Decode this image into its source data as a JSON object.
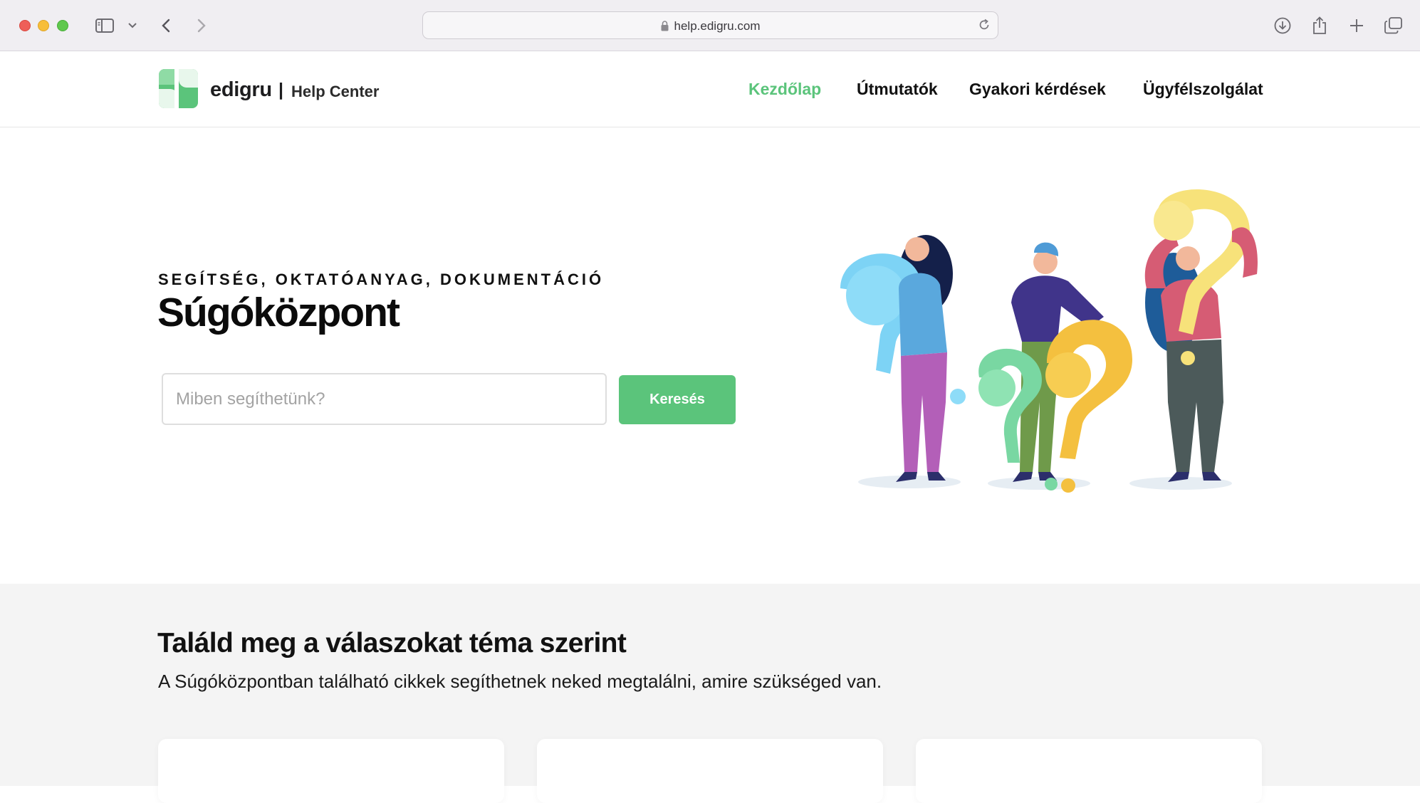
{
  "browser": {
    "url": "help.edigru.com"
  },
  "header": {
    "brand": "edigru",
    "separator": "|",
    "subtitle": "Help Center",
    "nav": [
      {
        "label": "Kezdőlap",
        "active": true
      },
      {
        "label": "Útmutatók",
        "active": false
      },
      {
        "label": "Gyakori kérdések",
        "active": false
      },
      {
        "label": "Ügyfélszolgálat",
        "active": false
      }
    ]
  },
  "hero": {
    "eyebrow": "SEGÍTSÉG, OKTATÓANYAG, DOKUMENTÁCIÓ",
    "title": "Súgóközpont",
    "search_placeholder": "Miben segíthetünk?",
    "search_button": "Keresés"
  },
  "topics": {
    "title": "Találd meg a válaszokat téma szerint",
    "subtitle": "A Súgóközpontban található cikkek segíthetnek neked megtalálni, amire szükséged van."
  },
  "colors": {
    "accent": "#5bc47b",
    "chrome": "#f0eef2",
    "section_bg": "#f4f4f4"
  },
  "icons": [
    "sidebar-icon",
    "chevron-down-icon",
    "back-icon",
    "forward-icon",
    "lock-icon",
    "reload-icon",
    "download-icon",
    "share-icon",
    "new-tab-icon",
    "tabs-overview-icon"
  ]
}
